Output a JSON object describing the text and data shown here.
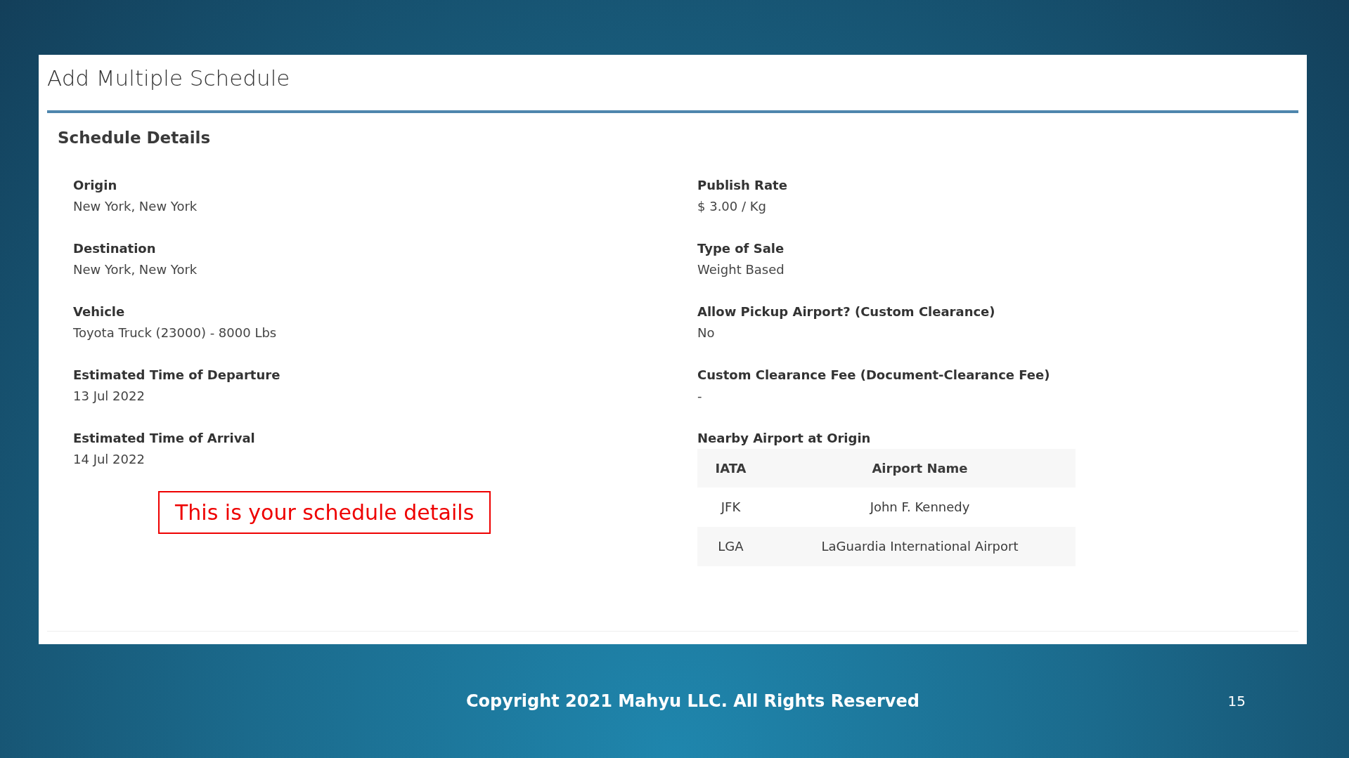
{
  "page": {
    "title": "Add Multiple Schedule"
  },
  "section": {
    "title": "Schedule Details"
  },
  "left_fields": [
    {
      "label": "Origin",
      "value": "New York, New York"
    },
    {
      "label": "Destination",
      "value": "New York, New York"
    },
    {
      "label": "Vehicle",
      "value": "Toyota Truck (23000) - 8000 Lbs"
    },
    {
      "label": "Estimated Time of Departure",
      "value": "13 Jul 2022"
    },
    {
      "label": "Estimated Time of Arrival",
      "value": "14 Jul 2022"
    }
  ],
  "right_fields": [
    {
      "label": "Publish Rate",
      "value": "$ 3.00 / Kg"
    },
    {
      "label": "Type of Sale",
      "value": "Weight Based"
    },
    {
      "label": "Allow Pickup Airport? (Custom Clearance)",
      "value": "No"
    },
    {
      "label": "Custom Clearance Fee (Document-Clearance Fee)",
      "value": "-"
    }
  ],
  "airports": {
    "label": "Nearby Airport at Origin",
    "columns": [
      "IATA",
      "Airport Name"
    ],
    "rows": [
      [
        "JFK",
        "John F. Kennedy"
      ],
      [
        "LGA",
        "LaGuardia International Airport"
      ]
    ]
  },
  "callout": "This is your schedule details",
  "footer": {
    "copyright": "Copyright 2021 Mahyu LLC. All Rights Reserved",
    "page_number": "15"
  }
}
